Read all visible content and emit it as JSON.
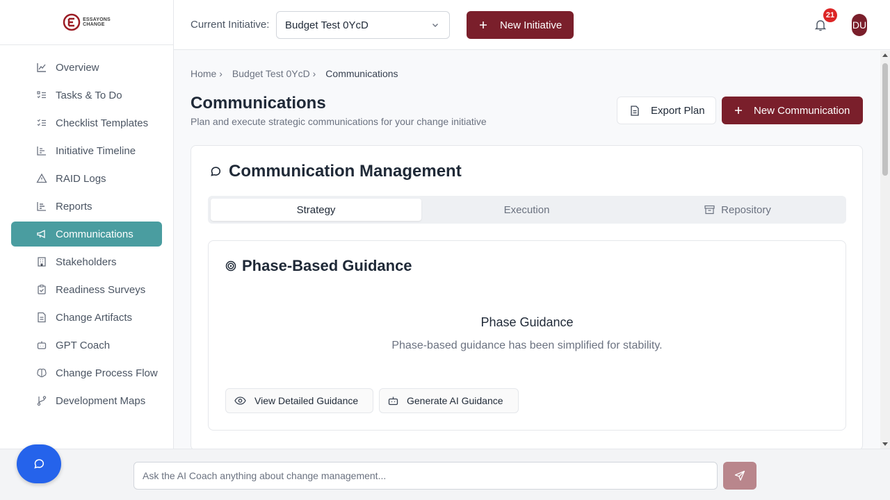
{
  "brand": {
    "logo_line1": "ESSAYONS",
    "logo_line2": "CHANGE",
    "accent": "#7a1f2b",
    "active_nav": "#4a9da0"
  },
  "sidebar": {
    "items": [
      {
        "label": "Overview",
        "icon": "chart-line-icon"
      },
      {
        "label": "Tasks & To Do",
        "icon": "list-todo-icon"
      },
      {
        "label": "Checklist Templates",
        "icon": "list-checks-icon"
      },
      {
        "label": "Initiative Timeline",
        "icon": "timeline-icon"
      },
      {
        "label": "RAID Logs",
        "icon": "warning-triangle-icon"
      },
      {
        "label": "Reports",
        "icon": "bar-chart-icon"
      },
      {
        "label": "Communications",
        "icon": "megaphone-icon",
        "active": true
      },
      {
        "label": "Stakeholders",
        "icon": "building-icon"
      },
      {
        "label": "Readiness Surveys",
        "icon": "clipboard-check-icon"
      },
      {
        "label": "Change Artifacts",
        "icon": "file-text-icon"
      },
      {
        "label": "GPT Coach",
        "icon": "bot-icon"
      },
      {
        "label": "Change Process Flow",
        "icon": "brain-icon"
      },
      {
        "label": "Development Maps",
        "icon": "git-branch-icon"
      }
    ]
  },
  "header": {
    "current_label": "Current Initiative:",
    "current_value": "Budget Test 0YcD",
    "new_initiative": "New Initiative",
    "notification_count": "21",
    "avatar_initials": "DU"
  },
  "breadcrumb": [
    "Home",
    "Budget Test 0YcD",
    "Communications"
  ],
  "page": {
    "title": "Communications",
    "subtitle": "Plan and execute strategic communications for your change initiative",
    "export_label": "Export Plan",
    "new_comm_label": "New Communication"
  },
  "card": {
    "title": "Communication Management",
    "tabs": [
      "Strategy",
      "Execution",
      "Repository"
    ],
    "inner_title": "Phase-Based Guidance",
    "guidance_title": "Phase Guidance",
    "guidance_text": "Phase-based guidance has been simplified for stability.",
    "view_btn": "View Detailed Guidance",
    "generate_btn": "Generate AI Guidance"
  },
  "bottom": {
    "ask_placeholder": "Ask the AI Coach anything about change management..."
  }
}
